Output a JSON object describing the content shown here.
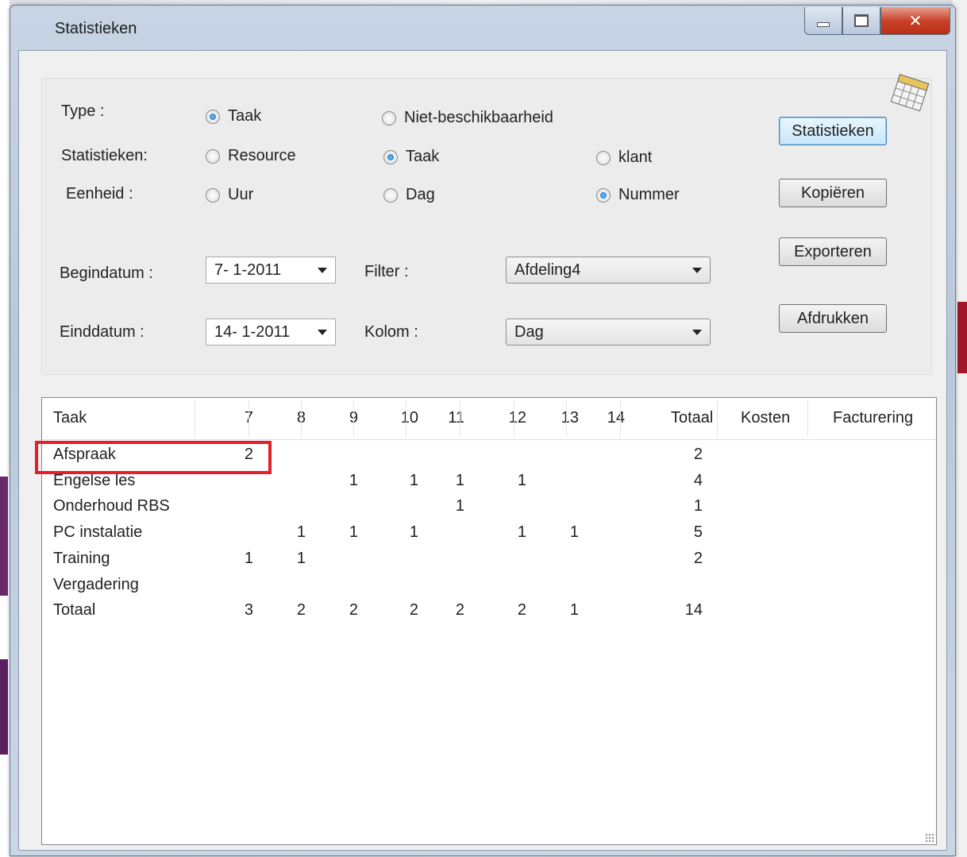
{
  "window": {
    "title": "Statistieken"
  },
  "form": {
    "type_label": "Type :",
    "type_options": [
      "Taak",
      "Niet-beschikbaarheid"
    ],
    "stats_label": "Statistieken:",
    "stats_options": [
      "Resource",
      "Taak",
      "klant"
    ],
    "unit_label": "Eenheid :",
    "unit_options": [
      "Uur",
      "Dag",
      "Nummer"
    ],
    "start_label": "Begindatum :",
    "start_value": "7- 1-2011",
    "end_label": "Einddatum :",
    "end_value": "14- 1-2011",
    "filter_label": "Filter :",
    "filter_value": "Afdeling4",
    "column_label": "Kolom :",
    "column_value": "Dag"
  },
  "buttons": {
    "statistics": "Statistieken",
    "copy": "Kopiëren",
    "export": "Exporteren",
    "print": "Afdrukken"
  },
  "table": {
    "headers": [
      "Taak",
      "7",
      "8",
      "9",
      "10",
      "11",
      "12",
      "13",
      "14",
      "Totaal",
      "Kosten",
      "Facturering"
    ],
    "rows": [
      [
        "Afspraak",
        "2",
        "",
        "",
        "",
        "",
        "",
        "",
        "",
        "2",
        "",
        ""
      ],
      [
        "Engelse les",
        "",
        "",
        "1",
        "1",
        "1",
        "1",
        "",
        "",
        "4",
        "",
        ""
      ],
      [
        "Onderhoud RBS",
        "",
        "",
        "",
        "",
        "1",
        "",
        "",
        "",
        "1",
        "",
        ""
      ],
      [
        "PC instalatie",
        "",
        "1",
        "1",
        "1",
        "",
        "1",
        "1",
        "",
        "5",
        "",
        ""
      ],
      [
        "Training",
        "1",
        "1",
        "",
        "",
        "",
        "",
        "",
        "",
        "2",
        "",
        ""
      ],
      [
        "Vergadering",
        "",
        "",
        "",
        "",
        "",
        "",
        "",
        "",
        "",
        "",
        ""
      ],
      [
        "Totaal",
        "3",
        "2",
        "2",
        "2",
        "2",
        "2",
        "1",
        "",
        "14",
        "",
        ""
      ]
    ]
  },
  "colors": {
    "highlight": "#e3202a",
    "accent": "#3c7fb1"
  }
}
